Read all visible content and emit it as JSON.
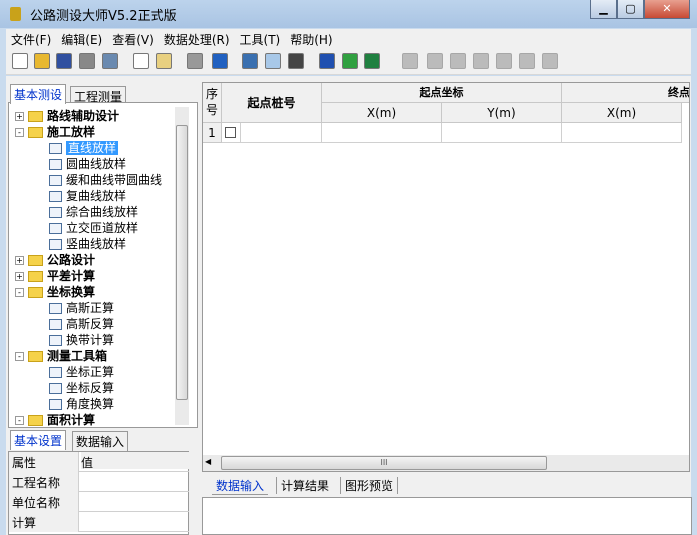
{
  "window": {
    "title": "公路测设大师V5.2正式版",
    "minimize": "▁",
    "maximize": "▢",
    "close": "✕"
  },
  "menu": [
    "文件(F)",
    "编辑(E)",
    "查看(V)",
    "数据处理(R)",
    "工具(T)",
    "帮助(H)"
  ],
  "toolbar": [
    "new-icon",
    "open-icon",
    "save-icon",
    "print-icon",
    "print-preview-icon",
    "copy-icon",
    "paste-icon",
    "settings-icon",
    "run-icon",
    "form-icon",
    "calculator-icon",
    "edit-icon",
    "font-icon",
    "excel-icon",
    "help-pointer-icon",
    "curve-icon",
    "rect-icon",
    "zoom-icon",
    "pan-icon",
    "fill-icon",
    "image-edit-icon",
    "text-style-icon"
  ],
  "left_tabs": [
    "基本测设",
    "工程测量"
  ],
  "tree": [
    {
      "label": "路线辅助设计",
      "level": 0,
      "exp": "+",
      "bold": true
    },
    {
      "label": "施工放样",
      "level": 0,
      "exp": "-",
      "bold": true
    },
    {
      "label": "直线放样",
      "level": 1,
      "selected": true
    },
    {
      "label": "圆曲线放样",
      "level": 1
    },
    {
      "label": "缓和曲线带圆曲线",
      "level": 1
    },
    {
      "label": "复曲线放样",
      "level": 1
    },
    {
      "label": "综合曲线放样",
      "level": 1
    },
    {
      "label": "立交匝道放样",
      "level": 1
    },
    {
      "label": "竖曲线放样",
      "level": 1
    },
    {
      "label": "公路设计",
      "level": 0,
      "exp": "+",
      "bold": true
    },
    {
      "label": "平差计算",
      "level": 0,
      "exp": "+",
      "bold": true
    },
    {
      "label": "坐标换算",
      "level": 0,
      "exp": "-",
      "bold": true
    },
    {
      "label": "高斯正算",
      "level": 1
    },
    {
      "label": "高斯反算",
      "level": 1
    },
    {
      "label": "换带计算",
      "level": 1
    },
    {
      "label": "测量工具箱",
      "level": 0,
      "exp": "-",
      "bold": true
    },
    {
      "label": "坐标正算",
      "level": 1
    },
    {
      "label": "坐标反算",
      "level": 1
    },
    {
      "label": "角度换算",
      "level": 1
    },
    {
      "label": "面积计算",
      "level": 0,
      "exp": "-",
      "bold": true
    }
  ],
  "bottom_left_tabs": [
    "基本设置",
    "数据输入"
  ],
  "props": {
    "header": [
      "属性",
      "值"
    ],
    "rows": [
      "工程名称",
      "单位名称",
      "计算"
    ]
  },
  "grid": {
    "seq": "序号",
    "start_station": "起点桩号",
    "start_coord": "起点坐标",
    "end_coord": "终点坐",
    "x": "X(m)",
    "y": "Y(m)",
    "row1": "1"
  },
  "hscroll_grip": "III",
  "bottom_tabs": [
    "数据输入",
    "计算结果",
    "图形预览"
  ]
}
